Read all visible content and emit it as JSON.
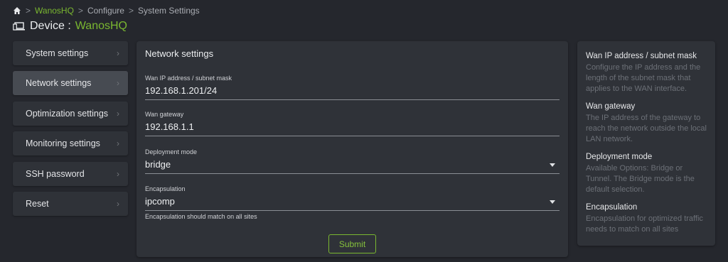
{
  "breadcrumb": {
    "home_icon": "home-icon",
    "separator": ">",
    "items": [
      "WanosHQ",
      "Configure",
      "System Settings"
    ]
  },
  "device": {
    "icon": "devices-icon",
    "label": "Device :",
    "name": "WanosHQ"
  },
  "colors": {
    "accent": "#7ab730",
    "background": "#25272d",
    "panel": "#2f3238",
    "active_item": "#474b52"
  },
  "sidebar": {
    "items": [
      {
        "label": "System settings",
        "active": false
      },
      {
        "label": "Network settings",
        "active": true
      },
      {
        "label": "Optimization settings",
        "active": false
      },
      {
        "label": "Monitoring settings",
        "active": false
      },
      {
        "label": "SSH password",
        "active": false
      },
      {
        "label": "Reset",
        "active": false
      }
    ],
    "chevron": "›"
  },
  "form": {
    "title": "Network settings",
    "fields": [
      {
        "label": "Wan IP address / subnet mask",
        "value": "192.168.1.201/24",
        "type": "text"
      },
      {
        "label": "Wan gateway",
        "value": "192.168.1.1",
        "type": "text"
      },
      {
        "label": "Deployment mode",
        "value": "bridge",
        "type": "select"
      },
      {
        "label": "Encapsulation",
        "value": "ipcomp",
        "type": "select"
      }
    ],
    "hint": "Encapsulation should match on all sites",
    "submit_label": "Submit"
  },
  "help": [
    {
      "title": "Wan IP address / subnet mask",
      "text": "Configure the IP address and the length of the subnet mask that applies to the WAN interface."
    },
    {
      "title": "Wan gateway",
      "text": "The IP address of the gateway to reach the network outside the local LAN network."
    },
    {
      "title": "Deployment mode",
      "text": "Available Options: Bridge or Tunnel. The Bridge mode is the default selection."
    },
    {
      "title": "Encapsulation",
      "text": "Encapsulation for optimized traffic needs to match on all sites"
    }
  ]
}
